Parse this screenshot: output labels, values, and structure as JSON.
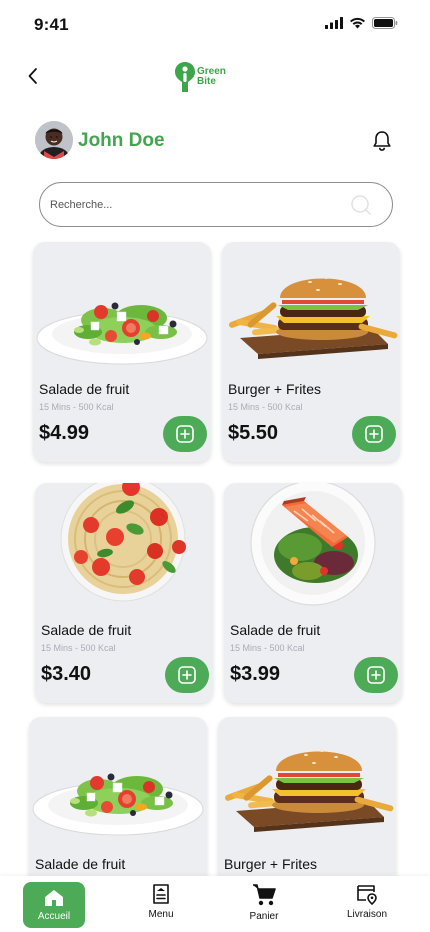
{
  "status": {
    "time": "9:41"
  },
  "logo": {
    "line1": "Green",
    "line2": "Bite"
  },
  "user": {
    "name": "John Doe"
  },
  "search": {
    "placeholder": "Recherche..."
  },
  "products": [
    {
      "title": "Salade de fruit",
      "meta": "15 Mins -  500 Kcal",
      "price": "$4.99",
      "image": "salad"
    },
    {
      "title": "Burger + Frites",
      "meta": "15 Mins -  500 Kcal",
      "price": "$5.50",
      "image": "burger"
    },
    {
      "title": "Salade de fruit",
      "meta": "15 Mins -  500 Kcal",
      "price": "$3.40",
      "image": "pasta"
    },
    {
      "title": "Salade de fruit",
      "meta": "15 Mins -  500 Kcal",
      "price": "$3.99",
      "image": "salmon"
    },
    {
      "title": "Salade de fruit",
      "meta": "",
      "price": "",
      "image": "salad"
    },
    {
      "title": "Burger + Frites",
      "meta": "",
      "price": "",
      "image": "burger"
    }
  ],
  "tabs": [
    {
      "label": "Accueil",
      "icon": "home-icon",
      "active": true
    },
    {
      "label": "Menu",
      "icon": "menu-icon",
      "active": false
    },
    {
      "label": "Panier",
      "icon": "cart-icon",
      "active": false
    },
    {
      "label": "Livraison",
      "icon": "delivery-icon",
      "active": false
    }
  ],
  "colors": {
    "accent": "#4daa57",
    "card": "#eceef2",
    "name": "#43a54f"
  }
}
